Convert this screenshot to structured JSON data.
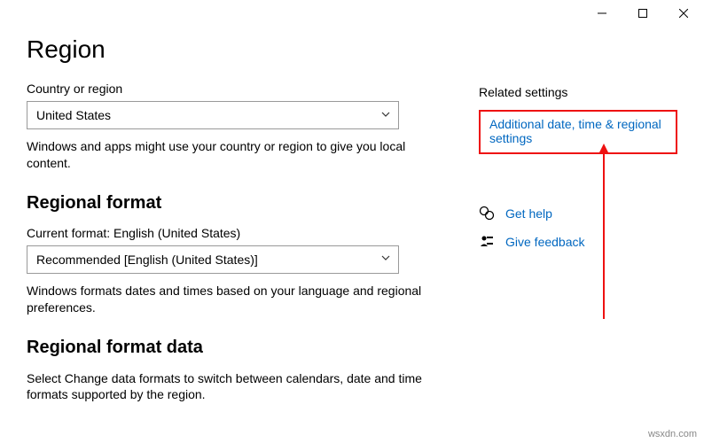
{
  "window": {
    "minimize": "Minimize",
    "maximize": "Maximize",
    "close": "Close"
  },
  "page": {
    "title": "Region",
    "country_label": "Country or region",
    "country_value": "United States",
    "country_desc": "Windows and apps might use your country or region to give you local content.",
    "regional_format_heading": "Regional format",
    "current_format_label": "Current format: English (United States)",
    "current_format_value": "Recommended [English (United States)]",
    "regional_format_desc": "Windows formats dates and times based on your language and regional preferences.",
    "regional_format_data_heading": "Regional format data",
    "regional_format_data_desc": "Select Change data formats to switch between calendars, date and time formats supported by the region."
  },
  "side": {
    "related_heading": "Related settings",
    "related_link": "Additional date, time & regional settings",
    "help_link": "Get help",
    "feedback_link": "Give feedback"
  },
  "watermark": "wsxdn.com"
}
